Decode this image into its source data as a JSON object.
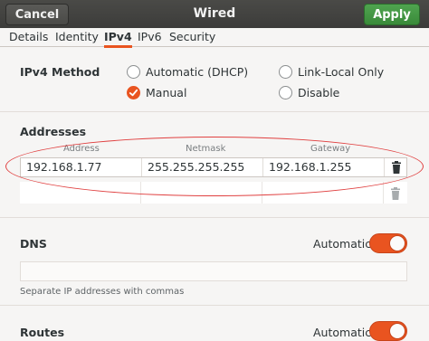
{
  "header": {
    "cancel_label": "Cancel",
    "title": "Wired",
    "apply_label": "Apply"
  },
  "tabs": [
    {
      "label": "Details"
    },
    {
      "label": "Identity"
    },
    {
      "label": "IPv4",
      "active": true
    },
    {
      "label": "IPv6"
    },
    {
      "label": "Security"
    }
  ],
  "ipv4_method": {
    "label": "IPv4 Method",
    "options": [
      {
        "label": "Automatic (DHCP)",
        "selected": false
      },
      {
        "label": "Link-Local Only",
        "selected": false
      },
      {
        "label": "Manual",
        "selected": true
      },
      {
        "label": "Disable",
        "selected": false
      }
    ]
  },
  "addresses": {
    "label": "Addresses",
    "columns": [
      "Address",
      "Netmask",
      "Gateway"
    ],
    "rows": [
      {
        "address": "192.168.1.77",
        "netmask": "255.255.255.255",
        "gateway": "192.168.1.255"
      },
      {
        "address": "",
        "netmask": "",
        "gateway": ""
      }
    ]
  },
  "dns": {
    "label": "DNS",
    "automatic_label": "Automatic",
    "automatic_on": true,
    "value": "",
    "hint": "Separate IP addresses with commas"
  },
  "routes": {
    "label": "Routes",
    "automatic_label": "Automatic",
    "automatic_on": true
  },
  "colors": {
    "accent": "#e95420",
    "apply_green": "#3a8a3a",
    "header_bg": "#3c3c3a",
    "annotation_red": "#e04040"
  },
  "icons": {
    "trash": "trash-icon",
    "check": "check-icon"
  }
}
